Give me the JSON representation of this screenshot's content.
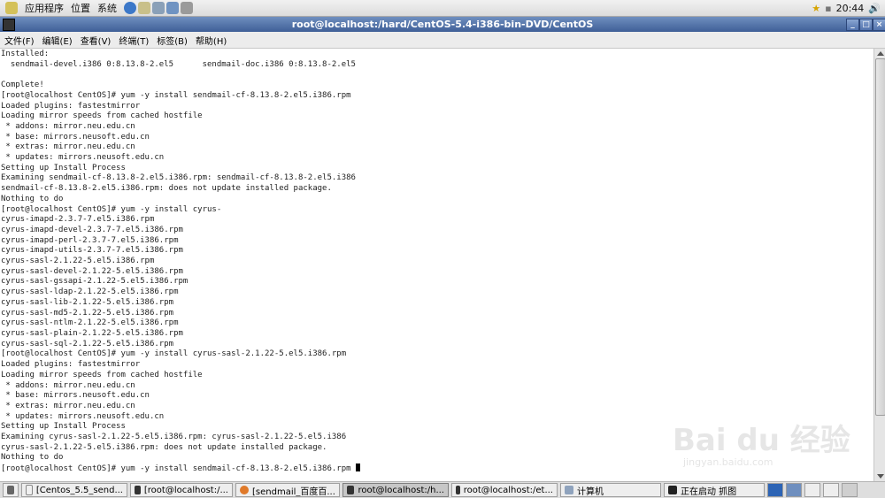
{
  "top_panel": {
    "menus": [
      "应用程序",
      "位置",
      "系统"
    ],
    "clock": "20:44"
  },
  "window": {
    "title": "root@localhost:/hard/CentOS-5.4-i386-bin-DVD/CentOS",
    "menus": [
      "文件(F)",
      "编辑(E)",
      "查看(V)",
      "终端(T)",
      "标签(B)",
      "帮助(H)"
    ]
  },
  "terminal_lines": [
    "Installed:",
    "  sendmail-devel.i386 0:8.13.8-2.el5      sendmail-doc.i386 0:8.13.8-2.el5",
    "",
    "Complete!",
    "[root@localhost CentOS]# yum -y install sendmail-cf-8.13.8-2.el5.i386.rpm",
    "Loaded plugins: fastestmirror",
    "Loading mirror speeds from cached hostfile",
    " * addons: mirror.neu.edu.cn",
    " * base: mirrors.neusoft.edu.cn",
    " * extras: mirror.neu.edu.cn",
    " * updates: mirrors.neusoft.edu.cn",
    "Setting up Install Process",
    "Examining sendmail-cf-8.13.8-2.el5.i386.rpm: sendmail-cf-8.13.8-2.el5.i386",
    "sendmail-cf-8.13.8-2.el5.i386.rpm: does not update installed package.",
    "Nothing to do",
    "[root@localhost CentOS]# yum -y install cyrus-",
    "cyrus-imapd-2.3.7-7.el5.i386.rpm",
    "cyrus-imapd-devel-2.3.7-7.el5.i386.rpm",
    "cyrus-imapd-perl-2.3.7-7.el5.i386.rpm",
    "cyrus-imapd-utils-2.3.7-7.el5.i386.rpm",
    "cyrus-sasl-2.1.22-5.el5.i386.rpm",
    "cyrus-sasl-devel-2.1.22-5.el5.i386.rpm",
    "cyrus-sasl-gssapi-2.1.22-5.el5.i386.rpm",
    "cyrus-sasl-ldap-2.1.22-5.el5.i386.rpm",
    "cyrus-sasl-lib-2.1.22-5.el5.i386.rpm",
    "cyrus-sasl-md5-2.1.22-5.el5.i386.rpm",
    "cyrus-sasl-ntlm-2.1.22-5.el5.i386.rpm",
    "cyrus-sasl-plain-2.1.22-5.el5.i386.rpm",
    "cyrus-sasl-sql-2.1.22-5.el5.i386.rpm",
    "[root@localhost CentOS]# yum -y install cyrus-sasl-2.1.22-5.el5.i386.rpm",
    "Loaded plugins: fastestmirror",
    "Loading mirror speeds from cached hostfile",
    " * addons: mirror.neu.edu.cn",
    " * base: mirrors.neusoft.edu.cn",
    " * extras: mirror.neu.edu.cn",
    " * updates: mirrors.neusoft.edu.cn",
    "Setting up Install Process",
    "Examining cyrus-sasl-2.1.22-5.el5.i386.rpm: cyrus-sasl-2.1.22-5.el5.i386",
    "cyrus-sasl-2.1.22-5.el5.i386.rpm: does not update installed package.",
    "Nothing to do",
    "[root@localhost CentOS]# yum -y install sendmail-cf-8.13.8-2.el5.i386.rpm "
  ],
  "watermark": {
    "brand": "Bai du 经验",
    "url": "jingyan.baidu.com"
  },
  "taskbar": [
    {
      "label": "[Centos_5.5_send...",
      "active": false
    },
    {
      "label": "[root@localhost:/...",
      "active": false
    },
    {
      "label": "[sendmail_百度百...",
      "active": false
    },
    {
      "label": "root@localhost:/h...",
      "active": true
    },
    {
      "label": "root@localhost:/et...",
      "active": false
    },
    {
      "label": "计算机",
      "active": false
    },
    {
      "label": "正在启动 抓图",
      "active": false
    }
  ]
}
